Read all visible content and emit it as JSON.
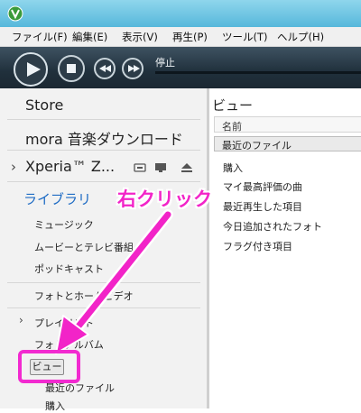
{
  "menu": {
    "items": [
      "ファイル(F)",
      "編集(E)",
      "表示(V)",
      "再生(P)",
      "ツール(T)",
      "ヘルプ(H)"
    ]
  },
  "player": {
    "status": "停止",
    "buttons": [
      "play-icon",
      "stop-icon",
      "previous-icon",
      "next-icon"
    ]
  },
  "sidebar": {
    "store": "Store",
    "mora": "mora 音楽ダウンロード",
    "device": "Xperia™ Z...",
    "library_title": "ライブラリ",
    "items": [
      "ミュージック",
      "ムービーとテレビ番組",
      "ポッドキャスト",
      "フォトとホームビデオ",
      "プレイリスト",
      "フォトアルバム",
      "ビュー",
      "最近のファイル",
      "購入"
    ]
  },
  "main": {
    "title": "ビュー",
    "column_header": "名前",
    "rows": [
      "最近のファイル",
      "購入",
      "マイ最高評価の曲",
      "最近再生した項目",
      "今日追加されたフォト",
      "フラグ付き項目"
    ]
  },
  "annotation": {
    "label": "右クリック",
    "color": "#f224c8"
  },
  "colors": {
    "accent_link": "#1d6bc4",
    "title_bar": "#56b8db",
    "player_bar": "#20303c"
  }
}
